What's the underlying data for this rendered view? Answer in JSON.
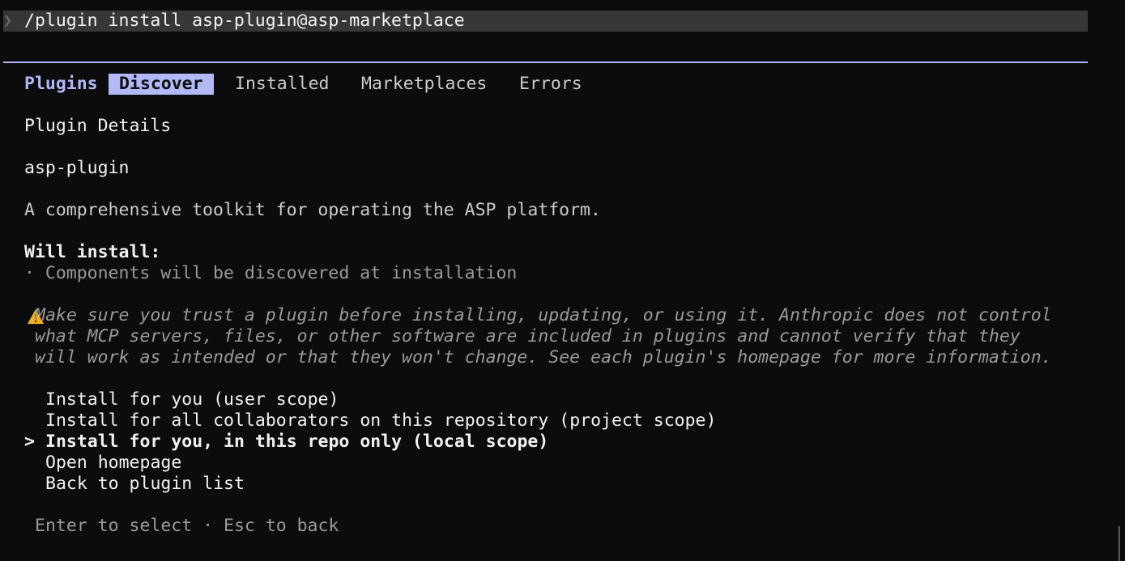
{
  "prompt": {
    "chevron_icon": "chevron-right-icon",
    "command": "/plugin install asp-plugin@asp-marketplace"
  },
  "tabs": {
    "title": "Plugins",
    "items": [
      {
        "label": "Discover",
        "active": true
      },
      {
        "label": "Installed",
        "active": false
      },
      {
        "label": "Marketplaces",
        "active": false
      },
      {
        "label": "Errors",
        "active": false
      }
    ]
  },
  "details": {
    "heading": "Plugin Details",
    "name": "asp-plugin",
    "description": "A comprehensive toolkit for operating the ASP platform.",
    "will_install_label": "Will install:",
    "components_note": "· Components will be discovered at installation"
  },
  "warning": {
    "icon": "warning-icon",
    "lines": [
      "Make sure you trust a plugin before installing, updating, or using it. Anthropic does not control",
      "what MCP servers, files, or other software are included in plugins and cannot verify that they",
      "will work as intended or that they won't change. See each plugin's homepage for more information."
    ]
  },
  "options": {
    "cursor": ">",
    "items": [
      {
        "label": "Install for you (user scope)",
        "selected": false
      },
      {
        "label": "Install for all collaborators on this repository (project scope)",
        "selected": false
      },
      {
        "label": "Install for you, in this repo only (local scope)",
        "selected": true
      },
      {
        "label": "Open homepage",
        "selected": false
      },
      {
        "label": "Back to plugin list",
        "selected": false
      }
    ]
  },
  "footer": {
    "hint": "Enter to select · Esc to back"
  },
  "colors": {
    "background": "#0c0c0c",
    "accent": "#b1b9f9",
    "prompt_bar": "#373737",
    "text": "#cccccc",
    "dim_text": "#9a9a9a",
    "warning": "#f2b01e"
  }
}
